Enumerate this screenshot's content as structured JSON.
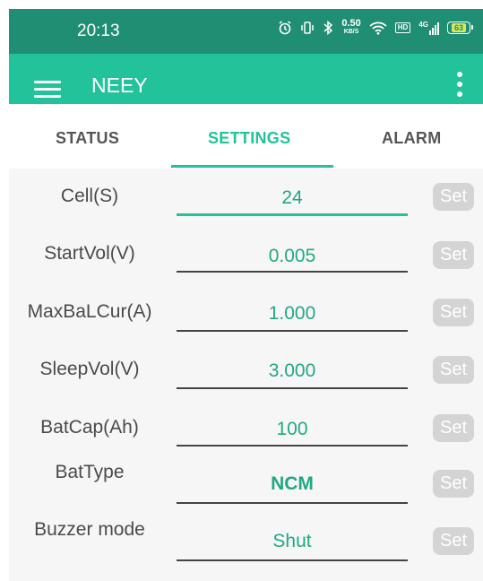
{
  "status_bar": {
    "time": "20:13",
    "net_speed_value": "0.50",
    "net_speed_unit": "KB/S",
    "hd_badge": "HD",
    "signal_label": "4G",
    "battery_level": "63"
  },
  "app_bar": {
    "title": "NEEY"
  },
  "tabs": [
    {
      "label": "STATUS",
      "active": false
    },
    {
      "label": "SETTINGS",
      "active": true
    },
    {
      "label": "ALARM",
      "active": false
    }
  ],
  "settings": {
    "set_label": "Set",
    "rows": [
      {
        "label": "Cell(S)",
        "value": "24"
      },
      {
        "label": "StartVol(V)",
        "value": "0.005"
      },
      {
        "label": "MaxBaLCur(A)",
        "value": "1.000"
      },
      {
        "label": "SleepVol(V)",
        "value": "3.000"
      },
      {
        "label": "BatCap(Ah)",
        "value": "100"
      },
      {
        "label": "BatType",
        "value": "NCM"
      },
      {
        "label": "Buzzer mode",
        "value": "Shut"
      }
    ]
  },
  "colors": {
    "status_bar": "#1f8e72",
    "accent": "#22c29b",
    "content_bg": "#f6f6f6",
    "set_button": "#d4d4d4"
  },
  "icons": [
    "alarm-clock-icon",
    "vibrate-icon",
    "bluetooth-icon",
    "wifi-icon",
    "hd-icon",
    "signal-icon",
    "battery-icon",
    "menu-icon",
    "more-vert-icon"
  ]
}
